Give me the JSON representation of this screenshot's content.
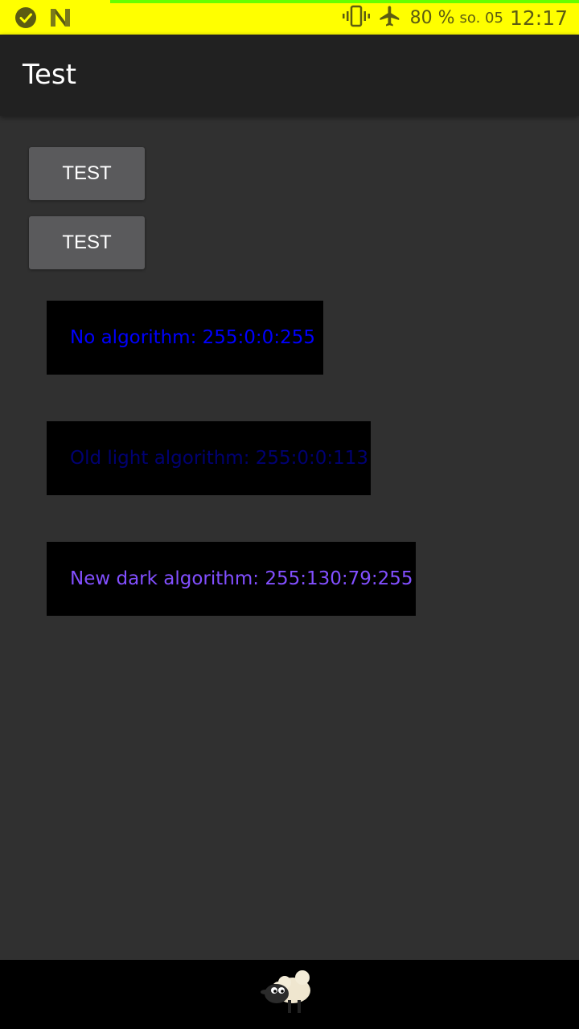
{
  "status_bar": {
    "battery_percent": "80 %",
    "date": "so. 05",
    "time": "12:17",
    "icons": [
      "check-circle-icon",
      "n-app-icon",
      "vibrate-icon",
      "airplane-mode-icon"
    ]
  },
  "app_bar": {
    "title": "Test"
  },
  "buttons": [
    {
      "label": "TEST"
    },
    {
      "label": "TEST"
    }
  ],
  "results": [
    {
      "text": "No algorithm: 255:0:0:255",
      "color": "#0000ff"
    },
    {
      "text": "Old light algorithm: 255:0:0:113",
      "color": "#000071"
    },
    {
      "text": "New dark algorithm: 255:130:79:255",
      "color": "#824fff"
    }
  ],
  "colors": {
    "status_bar_bg": "#ffff00",
    "app_bar_bg": "#212121",
    "background": "#303030",
    "button_bg": "#5a5a5c"
  },
  "nav_bar": {
    "icon": "sheep-mascot-icon"
  }
}
